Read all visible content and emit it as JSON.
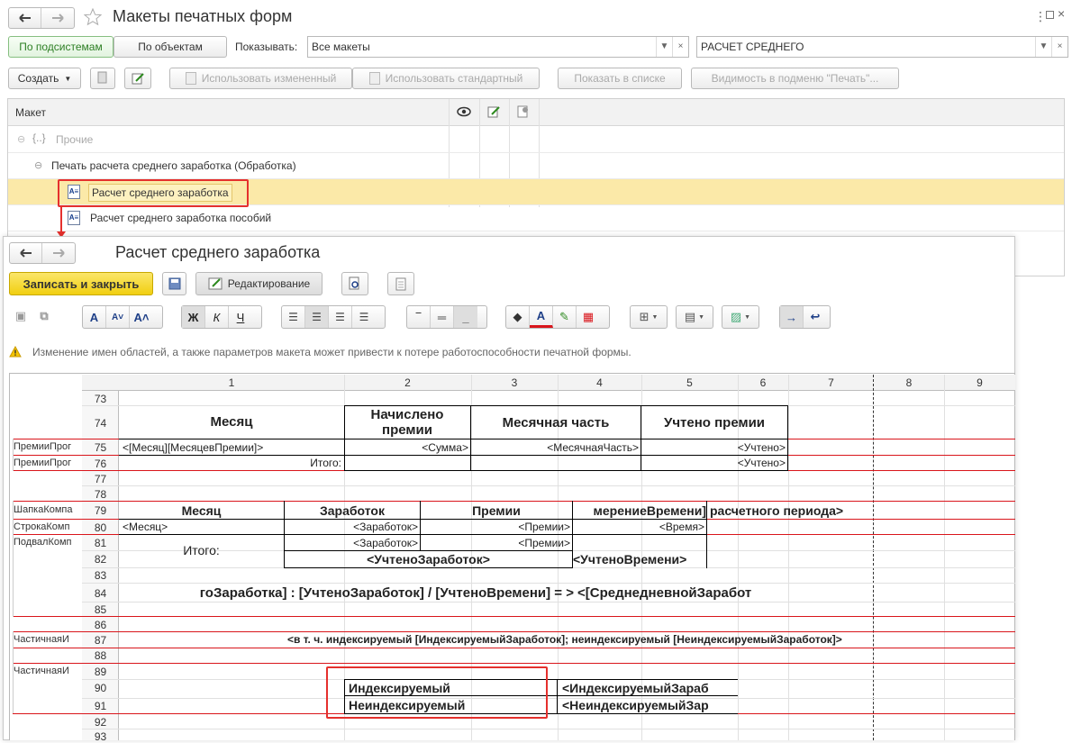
{
  "window": {
    "title": "Макеты печатных форм"
  },
  "toolbar1": {
    "by_subsystems": "По подсистемам",
    "by_objects": "По объектам",
    "show_label": "Показывать:",
    "show_value": "Все макеты",
    "filter_value": "РАСЧЕТ СРЕДНЕГО"
  },
  "toolbar2": {
    "create": "Создать",
    "use_changed": "Использовать измененный",
    "use_standard": "Использовать стандартный",
    "show_in_list": "Показать в списке",
    "visibility": "Видимость в подменю \"Печать\"..."
  },
  "tree": {
    "header": "Макет",
    "rows": [
      {
        "label": "Прочие"
      },
      {
        "label": "Печать расчета среднего заработка (Обработка)"
      },
      {
        "label": "Расчет среднего заработка"
      },
      {
        "label": "Расчет среднего заработка пособий"
      }
    ]
  },
  "form": {
    "title": "Расчет среднего заработка",
    "save_close": "Записать и закрыть",
    "editing": "Редактирование",
    "warning": "Изменение имен областей, а также параметров макета может привести к потере работоспособности печатной формы."
  },
  "sheet": {
    "columns": [
      "1",
      "2",
      "3",
      "4",
      "5",
      "6",
      "7",
      "8",
      "9"
    ],
    "rows": [
      "73",
      "74",
      "75",
      "76",
      "77",
      "78",
      "79",
      "80",
      "81",
      "82",
      "83",
      "84",
      "85",
      "86",
      "87",
      "88",
      "89",
      "90",
      "91",
      "92",
      "93"
    ],
    "names": {
      "r75": "ПремииПрог",
      "r76": "ПремииПрог",
      "r79": "ШапкаКомпа",
      "r80": "СтрокаКомп",
      "r81": "ПодвалКомп",
      "r87": "ЧастичнаяИ",
      "r89": "ЧастичнаяИ"
    },
    "cells": {
      "h_month": "Месяц",
      "h_accrued": "Начислено премии",
      "h_monthly": "Месячная часть",
      "h_counted": "Учтено премии",
      "r75_month": "<[Месяц][МесяцевПремии]>",
      "r75_sum": "<Сумма>",
      "r75_part": "<МесячнаяЧасть>",
      "r75_counted": "<Учтено>",
      "r76_total": "Итого:",
      "r76_counted": "<Учтено>",
      "h79_month": "Месяц",
      "h79_earn": "Заработок",
      "h79_bonus": "Премии",
      "h79_time": "мерениеВремени]",
      "h79_period": "расчетного периода>",
      "r80_month": "<Месяц>",
      "r80_earn": "<Заработок>",
      "r80_bonus": "<Премии>",
      "r80_time": "<Время>",
      "r81_total": "Итого:",
      "r81_earn": "<Заработок>",
      "r81_bonus": "<Премии>",
      "r82_earn": "<УчтеноЗаработок>",
      "r82_time": "<УчтеноВремени>",
      "r84_formula": "гоЗаработка] : [УчтеноЗаработок] / [УчтеноВремени] = >",
      "r84_avg": "<[СреднедневнойЗаработ",
      "r87_text": "<в т. ч. индексируемый [ИндексируемыйЗаработок]; неиндексируемый [НеиндексируемыйЗаработок]>",
      "r90_label": "Индексируемый",
      "r90_val": "<ИндексируемыйЗараб",
      "r91_label": "Неиндексируемый",
      "r91_val": "<НеиндексируемыйЗар"
    }
  },
  "colors": {
    "accent_green": "#4fa046",
    "highlight": "#fbe9a8",
    "red": "#d9151b",
    "yellow": "#f5d90f"
  }
}
